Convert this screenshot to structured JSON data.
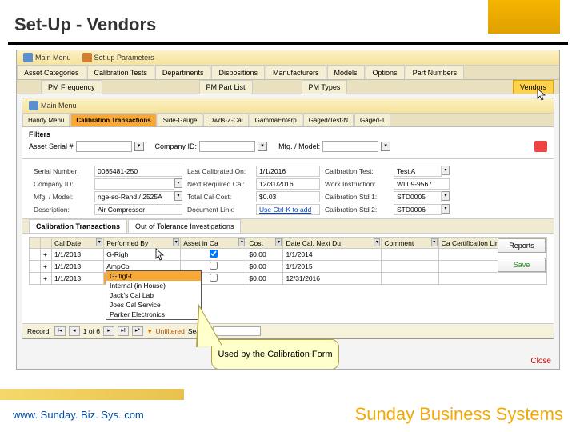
{
  "slide": {
    "title": "Set-Up - Vendors",
    "footer_url": "www. Sunday. Biz. Sys. com",
    "footer_brand": "Sunday Business Systems"
  },
  "ribbon": {
    "main_menu": "Main Menu",
    "set_up": "Set up Parameters"
  },
  "tabs_top": {
    "items": [
      "Asset Categories",
      "Calibration Tests",
      "Departments",
      "Dispositions",
      "Manufacturers",
      "Models",
      "Options",
      "Part Numbers"
    ],
    "row2": [
      "PM Frequency",
      "PM Part List",
      "PM Types"
    ],
    "vendors": "Vendors"
  },
  "sub_ribbon": {
    "main_menu": "Main Menu"
  },
  "sub_tabs": {
    "items": [
      "Handy Menu",
      "Calibration Transactions",
      "Side-Gauge",
      "Dwds-Z-Cal",
      "GammaEnterp",
      "Gaged/Test-N",
      "Gaged-1"
    ],
    "active": 1
  },
  "filters": {
    "title": "Filters",
    "serial_lbl": "Asset Serial #",
    "company_lbl": "Company ID:",
    "model_lbl": "Mfg. / Model:"
  },
  "form": {
    "serial": {
      "lbl": "Serial Number:",
      "val": "0085481-250"
    },
    "lastcal": {
      "lbl": "Last Calibrated On:",
      "val": "1/1/2016"
    },
    "caltest": {
      "lbl": "Calibration Test:",
      "val": "Test A"
    },
    "company": {
      "lbl": "Company ID:",
      "val": ""
    },
    "nextreq": {
      "lbl": "Next Required Cal:",
      "val": "12/31/2016"
    },
    "workinst": {
      "lbl": "Work Instruction:",
      "val": "WI 09-9567"
    },
    "mfg": {
      "lbl": "Mfg. / Model:",
      "val": "nge-so-Rand / 2525A"
    },
    "totalcost": {
      "lbl": "Total Cal Cost:",
      "val": "$0.03"
    },
    "std1": {
      "lbl": "Calibration Std 1:",
      "val": "STD0005"
    },
    "desc": {
      "lbl": "Description:",
      "val": "Air Compressor"
    },
    "doclink": {
      "lbl": "Document Link:",
      "val": "Use Ctrl-K to add"
    },
    "std2": {
      "lbl": "Calibration Std 2:",
      "val": "STD0006"
    }
  },
  "grid_tabs": {
    "t1": "Calibration Transactions",
    "t2": "Out of Tolerance Investigations"
  },
  "grid": {
    "cols": [
      "",
      "Cal Date",
      "Performed By",
      "Asset in Ca",
      "Cost",
      "Date Cal. Next Du",
      "Comment",
      "Ca Certification Link"
    ],
    "rows": [
      {
        "exp": "+",
        "date": "1/1/2013",
        "by": "G-Righ",
        "chk": true,
        "cost": "$0.00",
        "due": "1/1/2014",
        "comment": "",
        "cert": ""
      },
      {
        "exp": "+",
        "date": "1/1/2013",
        "by": "AmpCo",
        "chk": false,
        "cost": "$0.00",
        "due": "1/1/2015",
        "comment": "",
        "cert": ""
      },
      {
        "exp": "+",
        "date": "1/1/2013",
        "by": "G-ltigt-t",
        "chk": false,
        "cost": "$0.00",
        "due": "12/31/2016",
        "comment": "",
        "cert": ""
      }
    ]
  },
  "dropdown": {
    "items": [
      "Internal (in House)",
      "Jack's Cal Lab",
      "Joes Cal Service",
      "Parker Electronics"
    ],
    "selected": "G-ltigt-t"
  },
  "buttons": {
    "reports": "Reports",
    "save": "Save",
    "close": "Close"
  },
  "record_nav": {
    "label": "Record:",
    "pos": "1 of 6",
    "unfiltered": "Unfiltered",
    "search": "Search"
  },
  "callout": {
    "text": "Used by the Calibration Form"
  }
}
